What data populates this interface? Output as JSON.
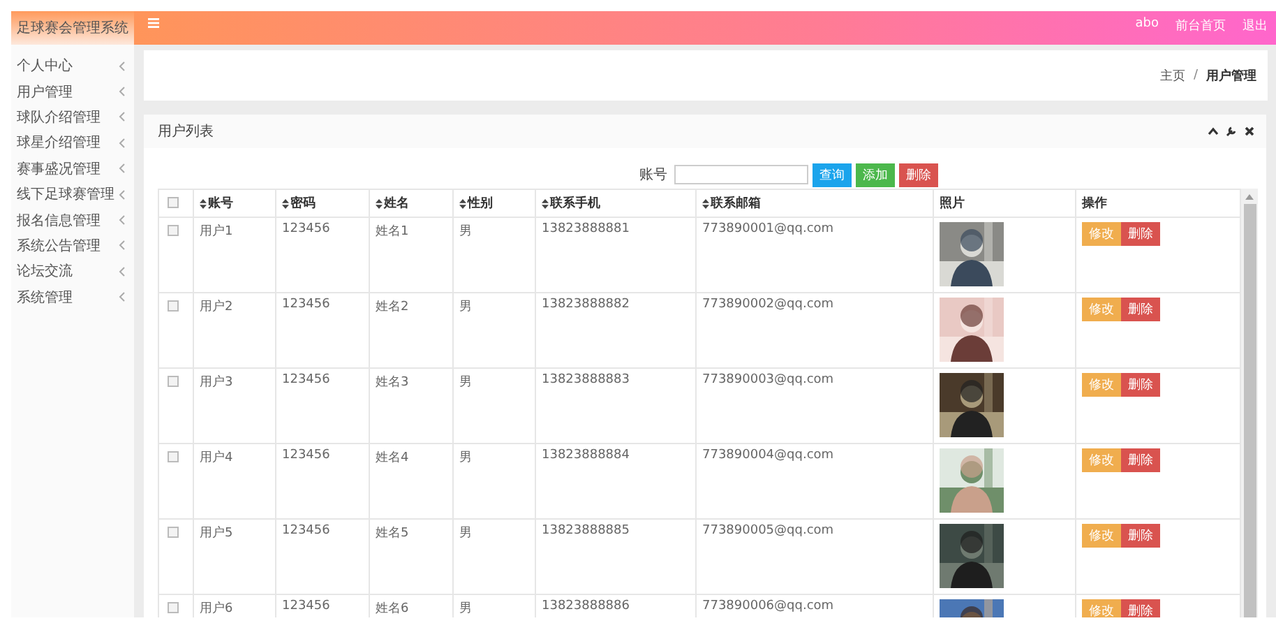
{
  "sidebar": {
    "title": "足球赛会管理系统",
    "items": [
      {
        "label": "个人中心"
      },
      {
        "label": "用户管理"
      },
      {
        "label": "球队介绍管理"
      },
      {
        "label": "球星介绍管理"
      },
      {
        "label": "赛事盛况管理"
      },
      {
        "label": "线下足球赛管理"
      },
      {
        "label": "报名信息管理"
      },
      {
        "label": "系统公告管理"
      },
      {
        "label": "论坛交流"
      },
      {
        "label": "系统管理"
      }
    ]
  },
  "header": {
    "links": [
      "abo",
      "前台首页",
      "退出"
    ]
  },
  "breadcrumb": {
    "separator": "/",
    "items": [
      "主页",
      "用户管理"
    ]
  },
  "panel": {
    "title": "用户列表",
    "search": {
      "label": "账号"
    },
    "buttons": [
      {
        "label": "查询",
        "kind": "query"
      },
      {
        "label": "添加",
        "kind": "add"
      },
      {
        "label": "删除",
        "kind": "delete"
      }
    ],
    "table": {
      "select_all": {
        "checked": false
      },
      "columns": [
        {
          "label": "账号",
          "sortable": true
        },
        {
          "label": "密码",
          "sortable": true
        },
        {
          "label": "姓名",
          "sortable": true
        },
        {
          "label": "性别",
          "sortable": true
        },
        {
          "label": "联系手机",
          "sortable": true
        },
        {
          "label": "联系邮箱",
          "sortable": true
        },
        {
          "label": "照片",
          "sortable": false
        },
        {
          "label": "操作",
          "sortable": false
        }
      ],
      "rows": [
        {
          "checked": false,
          "cells": [
            "用户1",
            "123456",
            "姓名1",
            "男",
            "13823888881",
            "773890001@qq.com"
          ],
          "photo": {
            "kind": "picture"
          },
          "actions": [
            "修改",
            "删除"
          ]
        },
        {
          "checked": false,
          "cells": [
            "用户2",
            "123456",
            "姓名2",
            "男",
            "13823888882",
            "773890002@qq.com"
          ],
          "photo": {
            "kind": "picture"
          },
          "actions": [
            "修改",
            "删除"
          ]
        },
        {
          "checked": false,
          "cells": [
            "用户3",
            "123456",
            "姓名3",
            "男",
            "13823888883",
            "773890003@qq.com"
          ],
          "photo": {
            "kind": "picture"
          },
          "actions": [
            "修改",
            "删除"
          ]
        },
        {
          "checked": false,
          "cells": [
            "用户4",
            "123456",
            "姓名4",
            "男",
            "13823888884",
            "773890004@qq.com"
          ],
          "photo": {
            "kind": "picture"
          },
          "actions": [
            "修改",
            "删除"
          ]
        },
        {
          "checked": false,
          "cells": [
            "用户5",
            "123456",
            "姓名5",
            "男",
            "13823888885",
            "773890005@qq.com"
          ],
          "photo": {
            "kind": "picture"
          },
          "actions": [
            "修改",
            "删除"
          ]
        },
        {
          "checked": false,
          "cells": [
            "用户6",
            "123456",
            "姓名6",
            "男",
            "13823888886",
            "773890006@qq.com"
          ],
          "photo": {
            "kind": "picture"
          },
          "actions": [
            "修改",
            "删除"
          ]
        }
      ]
    }
  }
}
